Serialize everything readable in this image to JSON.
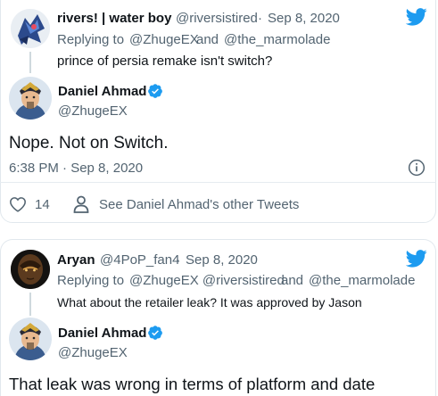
{
  "tweet1": {
    "author_name": "rivers! | water boy",
    "author_handle": "@riversistired",
    "separator": "·",
    "date": "Sep 8, 2020",
    "replying_label": "Replying to",
    "reply_handle_1": "@ZhugeEX",
    "reply_and": "and",
    "reply_handle_2": "@the_marmolade",
    "text": "prince of persia remake isn't switch?"
  },
  "tweet1_reply": {
    "author_name": "Daniel Ahmad",
    "author_handle": "@ZhugeEX",
    "text": "Nope. Not on Switch.",
    "timestamp": "6:38 PM · Sep 8, 2020",
    "like_count": "14",
    "other_tweets_label": "See Daniel Ahmad's other Tweets"
  },
  "tweet2": {
    "author_name": "Aryan",
    "author_handle": "@4PoP_fan4",
    "separator": "·",
    "date": "Sep 8, 2020",
    "replying_label": "Replying to",
    "reply_handles": "@ZhugeEX @riversistired",
    "reply_and": "and",
    "reply_handle_last": "@the_marmolade",
    "text": "What about the retailer leak? It was approved by Jason"
  },
  "tweet2_reply": {
    "author_name": "Daniel Ahmad",
    "author_handle": "@ZhugeEX",
    "text": "That leak was wrong in terms of platform and date"
  },
  "colors": {
    "twitter_blue": "#1d9bf0",
    "muted_text": "#536471",
    "primary_text": "#0f1419",
    "border": "#e1e8ed"
  },
  "icons": [
    "twitter-bird-icon",
    "verified-badge-icon",
    "info-icon",
    "heart-icon",
    "person-icon"
  ]
}
